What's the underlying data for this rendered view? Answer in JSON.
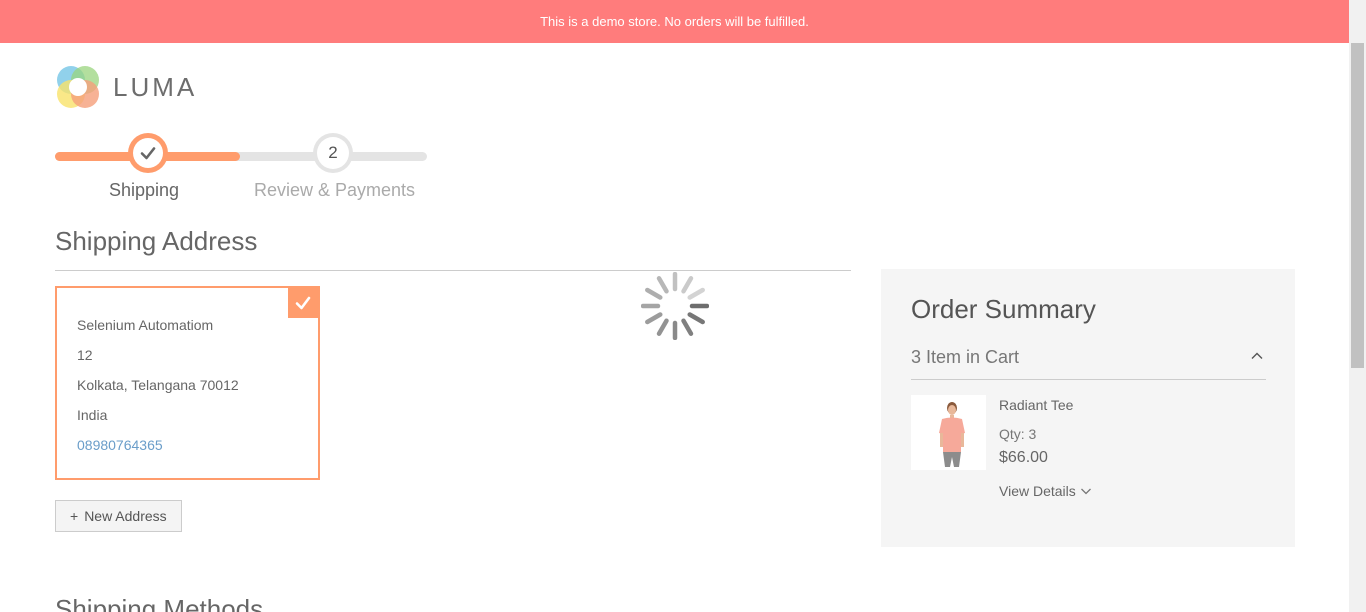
{
  "notice": {
    "text": "This is a demo store. No orders will be fulfilled."
  },
  "header": {
    "logo_text": "LUMA"
  },
  "progress": {
    "steps": [
      {
        "number": "",
        "label": "Shipping",
        "state": "complete"
      },
      {
        "number": "2",
        "label": "Review & Payments",
        "state": "pending"
      }
    ]
  },
  "shipping": {
    "title": "Shipping Address",
    "address": {
      "name": "Selenium Automatiom",
      "street": "12",
      "city_line": "Kolkata, Telangana 70012",
      "country": "India",
      "phone": "08980764365"
    },
    "new_address_label": "New Address",
    "new_address_icon": "+",
    "methods_title": "Shipping Methods"
  },
  "summary": {
    "title": "Order Summary",
    "cart_count": "3 Item in Cart",
    "items": [
      {
        "name": "Radiant Tee",
        "qty": "Qty: 3",
        "price": "$66.00",
        "details_label": "View Details"
      }
    ]
  },
  "colors": {
    "notice_bg": "#ff7c7c",
    "accent": "#ff9c6c",
    "link": "#6a9dc9"
  }
}
